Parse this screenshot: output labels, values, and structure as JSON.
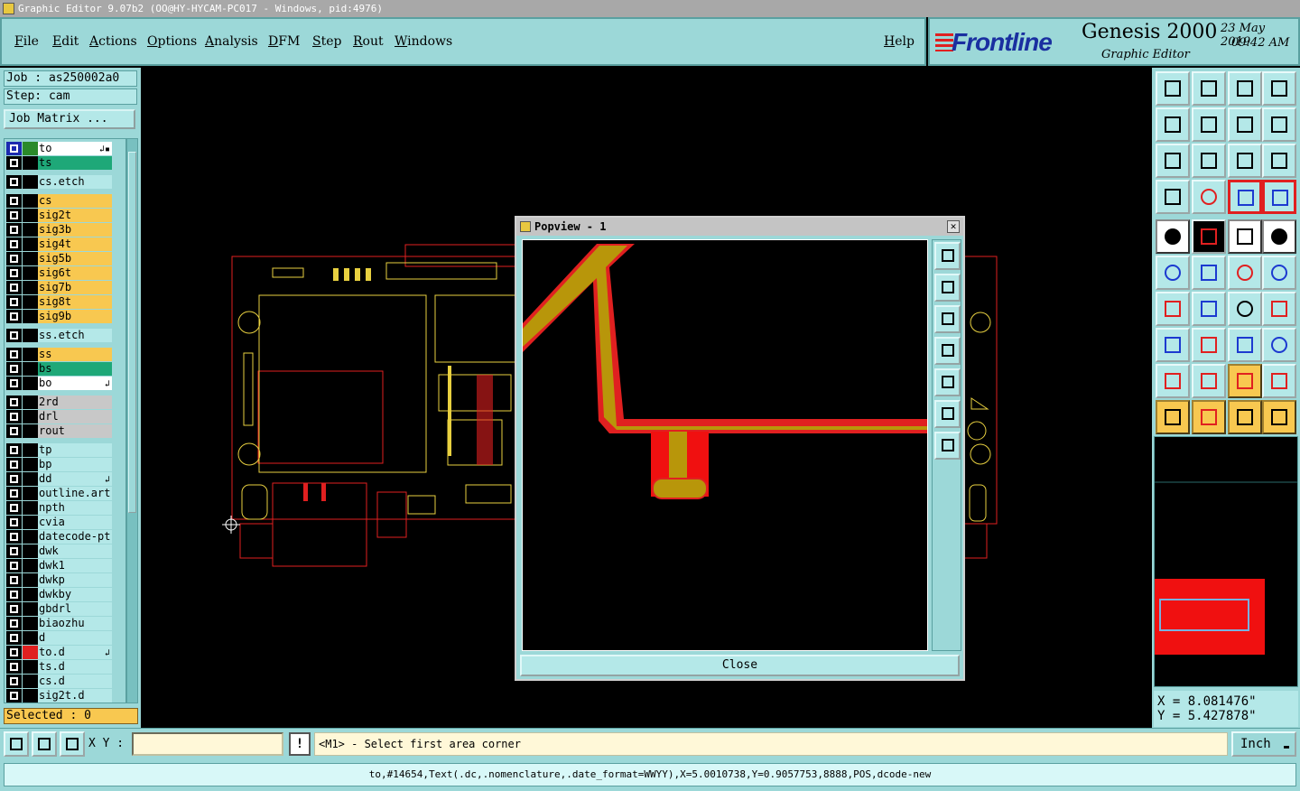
{
  "window": {
    "title": "Graphic Editor 9.07b2 (OO@HY-HYCAM-PC017 - Windows, pid:4976)"
  },
  "menu": {
    "items": [
      "File",
      "Edit",
      "Actions",
      "Options",
      "Analysis",
      "DFM",
      "Step",
      "Rout",
      "Windows"
    ],
    "help": "Help"
  },
  "brand": {
    "logo": "Frontline",
    "product": "Genesis 2000",
    "subtitle": "Graphic Editor",
    "date": "23 May 2019",
    "time": "09:42 AM"
  },
  "job": {
    "job_line": "Job : as250002a0",
    "step_line": "Step: cam",
    "matrix_button": "Job Matrix ..."
  },
  "layers": [
    {
      "name": "to",
      "color": "#ffffff",
      "ctrl2": "#2a8a2a",
      "box_blue": true,
      "mark": "↲▪"
    },
    {
      "name": "ts",
      "color": "#1ea878",
      "ctrl2": "#000000"
    },
    {
      "name": "cs.etch",
      "color": "#b4e8e8",
      "ctrl2": "#000000"
    },
    {
      "name": "cs",
      "color": "#f8c850",
      "ctrl2": "#000000"
    },
    {
      "name": "sig2t",
      "color": "#f8c850",
      "ctrl2": "#000000"
    },
    {
      "name": "sig3b",
      "color": "#f8c850",
      "ctrl2": "#000000"
    },
    {
      "name": "sig4t",
      "color": "#f8c850",
      "ctrl2": "#000000"
    },
    {
      "name": "sig5b",
      "color": "#f8c850",
      "ctrl2": "#000000"
    },
    {
      "name": "sig6t",
      "color": "#f8c850",
      "ctrl2": "#000000"
    },
    {
      "name": "sig7b",
      "color": "#f8c850",
      "ctrl2": "#000000"
    },
    {
      "name": "sig8t",
      "color": "#f8c850",
      "ctrl2": "#000000"
    },
    {
      "name": "sig9b",
      "color": "#f8c850",
      "ctrl2": "#000000"
    },
    {
      "name": "ss.etch",
      "color": "#b4e8e8",
      "ctrl2": "#000000"
    },
    {
      "name": "ss",
      "color": "#f8c850",
      "ctrl2": "#000000"
    },
    {
      "name": "bs",
      "color": "#1ea878",
      "ctrl2": "#000000"
    },
    {
      "name": "bo",
      "color": "#ffffff",
      "ctrl2": "#000000",
      "mark": "↲"
    },
    {
      "name": "2rd",
      "color": "#c8c8c8",
      "ctrl2": "#000000"
    },
    {
      "name": "drl",
      "color": "#c8c8c8",
      "ctrl2": "#000000"
    },
    {
      "name": "rout",
      "color": "#c8c8c8",
      "ctrl2": "#000000"
    },
    {
      "name": "tp",
      "color": "#b4e8e8",
      "ctrl2": "#000000"
    },
    {
      "name": "bp",
      "color": "#b4e8e8",
      "ctrl2": "#000000"
    },
    {
      "name": "dd",
      "color": "#b4e8e8",
      "ctrl2": "#000000",
      "mark": "↲"
    },
    {
      "name": "outline.art",
      "color": "#b4e8e8",
      "ctrl2": "#000000"
    },
    {
      "name": "npth",
      "color": "#b4e8e8",
      "ctrl2": "#000000"
    },
    {
      "name": "cvia",
      "color": "#b4e8e8",
      "ctrl2": "#000000"
    },
    {
      "name": "datecode-pt",
      "color": "#b4e8e8",
      "ctrl2": "#000000"
    },
    {
      "name": "dwk",
      "color": "#b4e8e8",
      "ctrl2": "#000000"
    },
    {
      "name": "dwk1",
      "color": "#b4e8e8",
      "ctrl2": "#000000"
    },
    {
      "name": "dwkp",
      "color": "#b4e8e8",
      "ctrl2": "#000000"
    },
    {
      "name": "dwkby",
      "color": "#b4e8e8",
      "ctrl2": "#000000"
    },
    {
      "name": "gbdrl",
      "color": "#b4e8e8",
      "ctrl2": "#000000"
    },
    {
      "name": "biaozhu",
      "color": "#b4e8e8",
      "ctrl2": "#000000"
    },
    {
      "name": "d",
      "color": "#b4e8e8",
      "ctrl2": "#000000"
    },
    {
      "name": "to.d",
      "color": "#b4e8e8",
      "ctrl2": "#e02020",
      "mark": "↲"
    },
    {
      "name": "ts.d",
      "color": "#b4e8e8",
      "ctrl2": "#000000"
    },
    {
      "name": "cs.d",
      "color": "#b4e8e8",
      "ctrl2": "#000000"
    },
    {
      "name": "sig2t.d",
      "color": "#b4e8e8",
      "ctrl2": "#000000"
    }
  ],
  "selected": "Selected : 0",
  "popview": {
    "title": "Popview - 1",
    "close_x": "✕",
    "close_button": "Close"
  },
  "readout": {
    "x": "X = 8.081476\"",
    "y": "Y = 5.427878\""
  },
  "cmdbar": {
    "xy_label": "X Y :",
    "xy_value": "",
    "excl": "!",
    "prompt": "<M1> - Select first area corner",
    "unit": "Inch",
    "unit_arrow": "▬"
  },
  "status": "to,#14654,Text(.dc,.nomenclature,.date_format=WWYY),X=5.0010738,Y=0.9057753,8888,POS,dcode-new",
  "colors": {
    "panel": "#9cd8d8",
    "trace": "#b8960a",
    "pad": "#f01010",
    "outline": "#e02020",
    "silk": "#e8d040"
  }
}
